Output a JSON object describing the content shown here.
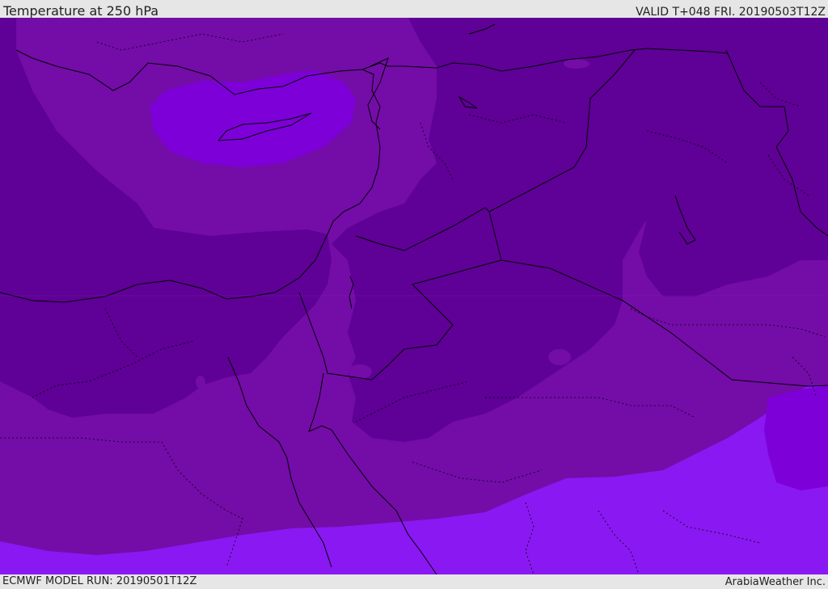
{
  "header": {
    "title": "Temperature at 250 hPa",
    "valid": "VALID T+048 FRI. 20190503T12Z"
  },
  "footer": {
    "model_run": "ECMWF MODEL RUN: 20190501T12Z",
    "credit": "ArabiaWeather Inc."
  },
  "colors": {
    "band_warmest": "#5f0096",
    "band_mid": "#740ca8",
    "band_cool": "#7d00d8",
    "band_coldest": "#8a18f2",
    "boundary_line": "#000000"
  },
  "map": {
    "field": "Temperature",
    "level": "250 hPa"
  }
}
